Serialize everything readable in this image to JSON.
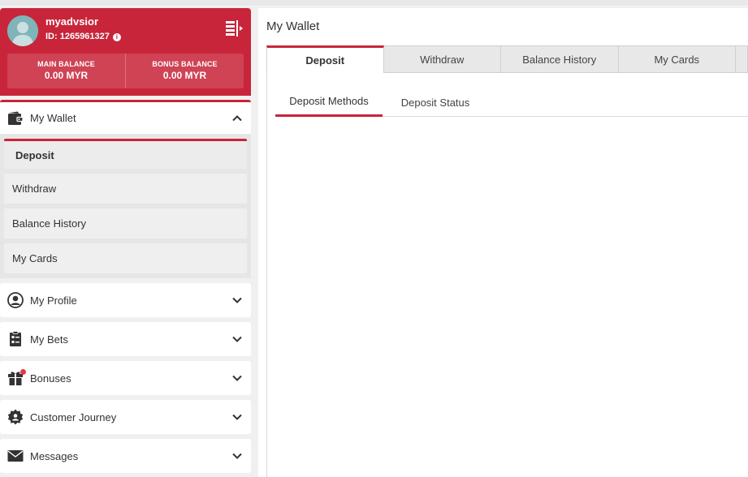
{
  "colors": {
    "brand": "#c8253a",
    "background": "#f0f0f0",
    "panel": "#ffffff"
  },
  "profile": {
    "username": "myadvsior",
    "user_id": "ID: 1265961327",
    "main_balance_label": "MAIN BALANCE",
    "main_balance_value": "0.00 MYR",
    "bonus_balance_label": "BONUS BALANCE",
    "bonus_balance_value": "0.00 MYR"
  },
  "sidebar": {
    "wallet": {
      "label": "My Wallet",
      "icon": "wallet-icon",
      "expanded": true,
      "items": [
        {
          "label": "Deposit",
          "active": true
        },
        {
          "label": "Withdraw"
        },
        {
          "label": "Balance History"
        },
        {
          "label": "My Cards"
        }
      ]
    },
    "sections": [
      {
        "label": "My Profile",
        "icon": "user-circle-icon"
      },
      {
        "label": "My Bets",
        "icon": "bet-slip-icon"
      },
      {
        "label": "Bonuses",
        "icon": "gift-icon"
      },
      {
        "label": "Customer Journey",
        "icon": "journey-badge-icon"
      },
      {
        "label": "Messages",
        "icon": "envelope-icon"
      }
    ]
  },
  "main": {
    "title": "My Wallet",
    "tabs": [
      {
        "label": "Deposit",
        "active": true
      },
      {
        "label": "Withdraw"
      },
      {
        "label": "Balance History"
      },
      {
        "label": "My Cards"
      }
    ],
    "subtabs": [
      {
        "label": "Deposit Methods",
        "active": true
      },
      {
        "label": "Deposit Status"
      }
    ]
  }
}
